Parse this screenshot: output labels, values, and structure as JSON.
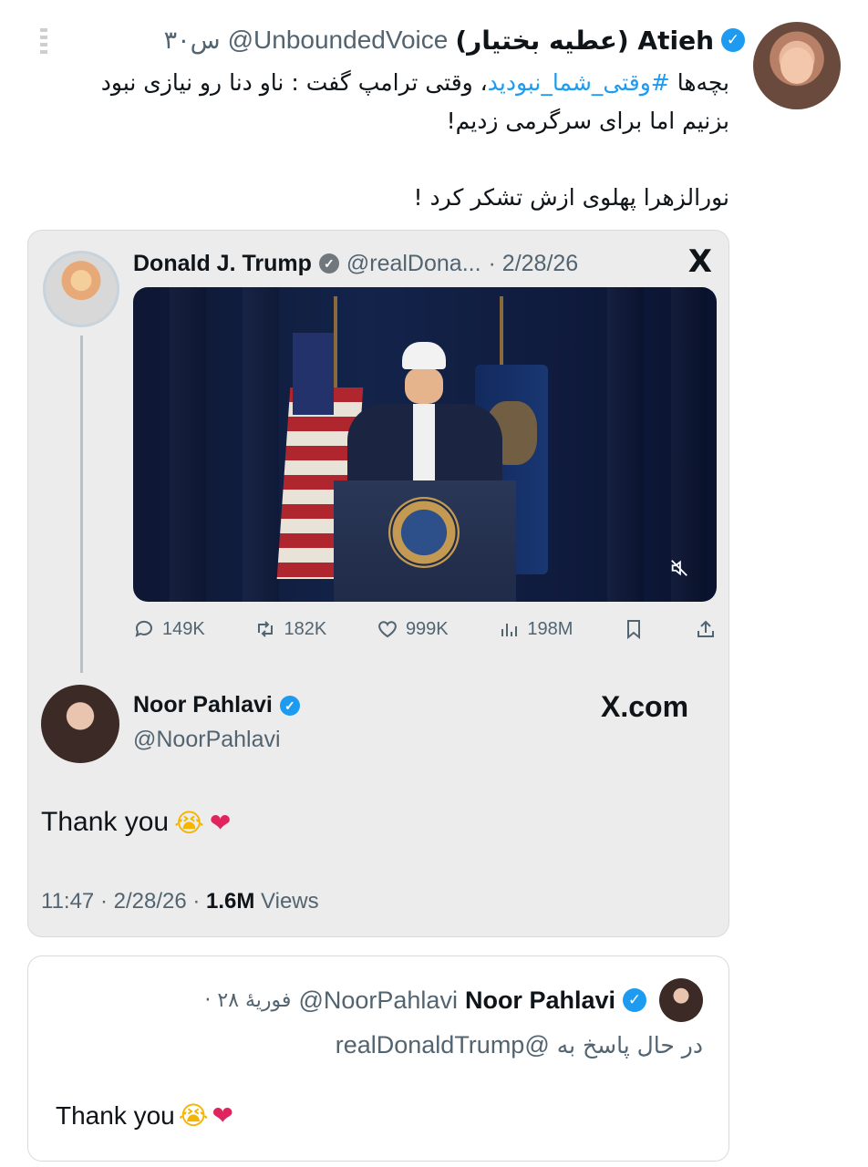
{
  "main_tweet": {
    "author_name": "(عطیه بختیار) Atieh",
    "handle": "@UnboundedVoice",
    "time": "۳۰س",
    "text_prefix": "بچه‌ها ",
    "hashtag": "#وقتی_شما_نبودید",
    "text_line1_rest": "، وقتی ترامپ گفت : ناو دنا رو نیازی نبود",
    "text_line2": "بزنیم اما برای سرگرمی زدیم!",
    "text_line3": "نورالزهرا پهلوی ازش تشکر کرد !"
  },
  "quoted_tweet": {
    "author_name": "Donald J. Trump",
    "handle": "@realDona...",
    "date": "· 2/28/26",
    "platform_logo": "X",
    "stats": {
      "replies": "149K",
      "retweets": "182K",
      "likes": "999K",
      "views": "198M"
    }
  },
  "noor_reply": {
    "name": "Noor Pahlavi",
    "handle": "@NoorPahlavi",
    "site": "X.com",
    "text": "Thank you",
    "emoji_cry": "😭",
    "emoji_heart": "❤",
    "time": "11:47 · 2/28/26 · ",
    "views_count": "1.6M",
    "views_label": " Views"
  },
  "reply_card": {
    "name": "Noor Pahlavi",
    "handle": "@NoorPahlavi",
    "date": "· ۲۸ فوریهٔ",
    "replying_label": "در حال پاسخ به ",
    "replying_mention": "@realDonaldTrump",
    "text": "Thank you",
    "emoji_cry": "😭",
    "emoji_heart": "❤"
  },
  "colors": {
    "accent": "#1d9bf0",
    "secondary_text": "#536471",
    "card_bg": "#ececec",
    "heart": "#e0245e"
  },
  "icons": [
    "verified-badge-icon",
    "x-logo-icon",
    "mute-icon",
    "reply-icon",
    "retweet-icon",
    "like-icon",
    "views-icon",
    "bookmark-icon",
    "share-icon"
  ]
}
